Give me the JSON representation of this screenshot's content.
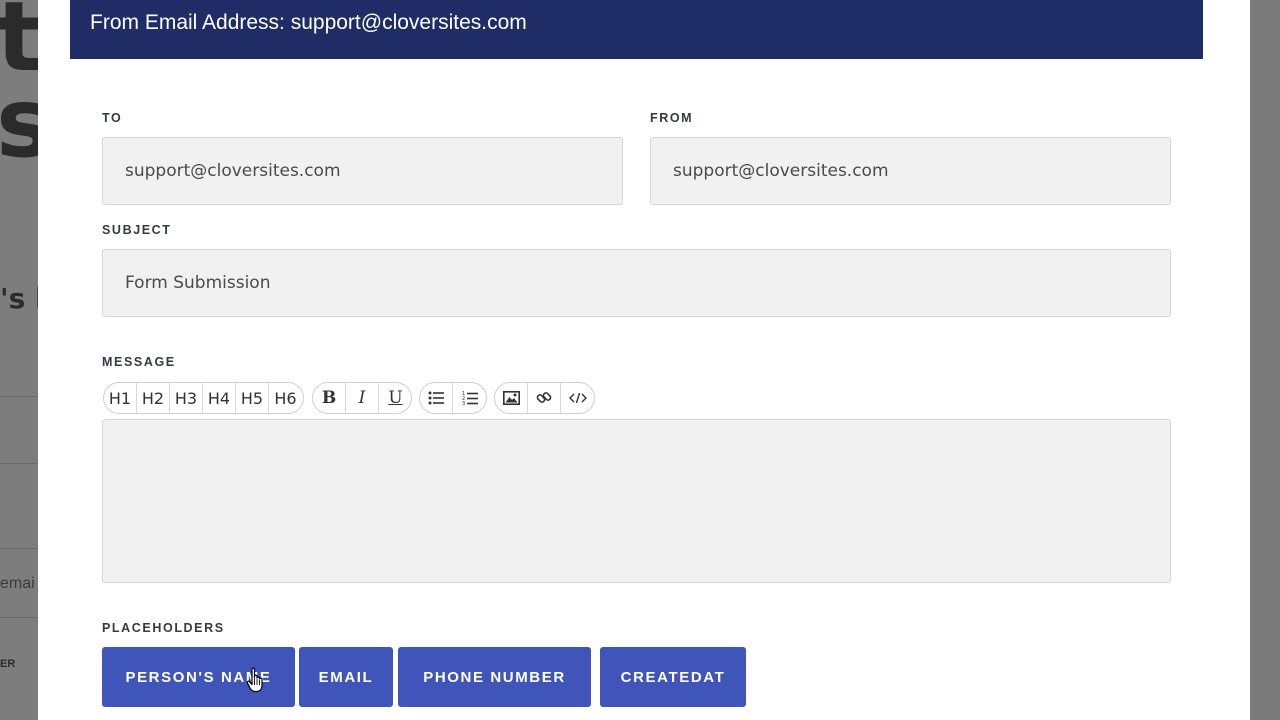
{
  "background_page": {
    "big_text_line1": "t",
    "big_text_line2": "s",
    "mid_text": "'s l",
    "small_text": "emai",
    "tiny_text": "ER"
  },
  "modal": {
    "header": {
      "from_email_line": "From Email Address: support@cloversites.com"
    },
    "to": {
      "label": "TO",
      "value": "support@cloversites.com"
    },
    "from": {
      "label": "FROM",
      "value": "support@cloversites.com"
    },
    "subject": {
      "label": "SUBJECT",
      "value": "Form Submission"
    },
    "message": {
      "label": "MESSAGE",
      "value": "",
      "toolbar": {
        "headings": [
          "H1",
          "H2",
          "H3",
          "H4",
          "H5",
          "H6"
        ],
        "bold": "B",
        "italic": "I",
        "underline": "U",
        "icons": [
          "bulleted-list-icon",
          "numbered-list-icon",
          "image-icon",
          "link-icon",
          "code-icon"
        ]
      }
    },
    "placeholders": {
      "label": "PLACEHOLDERS",
      "buttons": [
        "PERSON'S NAME",
        "EMAIL",
        "PHONE NUMBER",
        "CREATEDAT"
      ]
    }
  },
  "colors": {
    "header_bg": "#1f2c66",
    "placeholder_button_bg": "#3f55b9",
    "input_bg": "#f1f1f1"
  }
}
